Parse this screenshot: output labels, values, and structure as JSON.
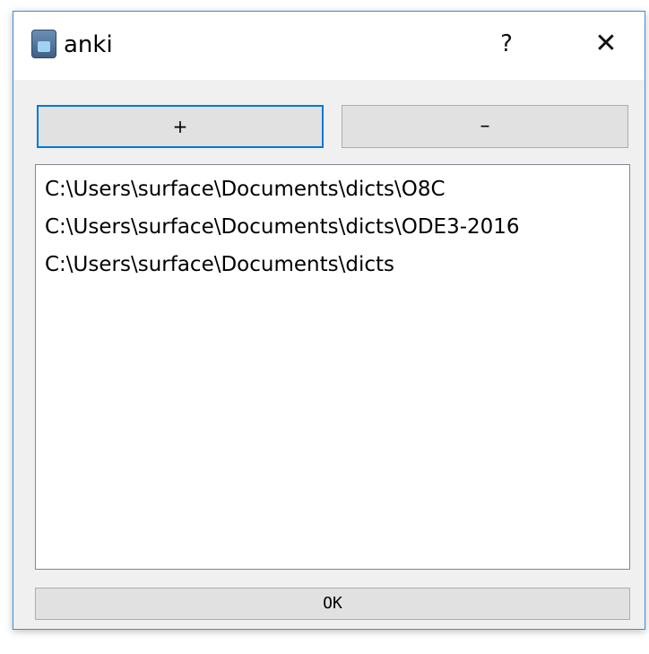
{
  "window": {
    "title": "anki",
    "help_label": "?",
    "close_label": "✕"
  },
  "toolbar": {
    "add_label": "+",
    "remove_label": "–"
  },
  "list": {
    "items": [
      "C:\\Users\\surface\\Documents\\dicts\\O8C",
      "C:\\Users\\surface\\Documents\\dicts\\ODE3-2016",
      "C:\\Users\\surface\\Documents\\dicts"
    ]
  },
  "footer": {
    "ok_label": "OK"
  },
  "colors": {
    "accent": "#0078d7",
    "button_face": "#e1e1e1",
    "dialog_bg": "#f0f0f0"
  }
}
